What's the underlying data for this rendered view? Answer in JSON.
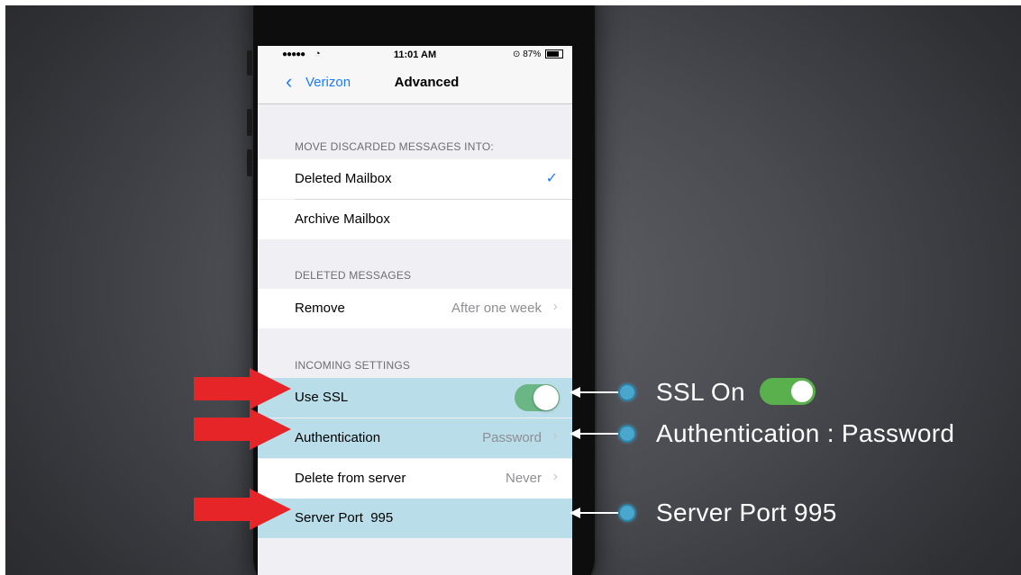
{
  "status_bar": {
    "signal": "●●●●●",
    "wifi": "wifi-icon",
    "time": "11:01 AM",
    "battery": "87%"
  },
  "nav": {
    "back_label": "Verizon",
    "title": "Advanced"
  },
  "sections": {
    "discard": {
      "header": "MOVE DISCARDED MESSAGES INTO:",
      "rows": [
        {
          "label": "Deleted Mailbox",
          "checked": true
        },
        {
          "label": "Archive Mailbox",
          "checked": false
        }
      ]
    },
    "deleted": {
      "header": "DELETED MESSAGES",
      "remove_label": "Remove",
      "remove_value": "After one week"
    },
    "incoming": {
      "header": "INCOMING SETTINGS",
      "use_ssl_label": "Use SSL",
      "use_ssl_on": true,
      "auth_label": "Authentication",
      "auth_value": "Password",
      "delete_label": "Delete from server",
      "delete_value": "Never",
      "port_label": "Server Port",
      "port_value": "995"
    }
  },
  "callouts": {
    "ssl": "SSL On",
    "auth": "Authentication : Password",
    "port": "Server Port 995"
  },
  "colors": {
    "ios_blue": "#1a7df7",
    "highlight": "#b9dde9",
    "toggle_green": "#6ab685",
    "arrow_red": "#e52528",
    "callout_dot": "#4aa6cc"
  }
}
